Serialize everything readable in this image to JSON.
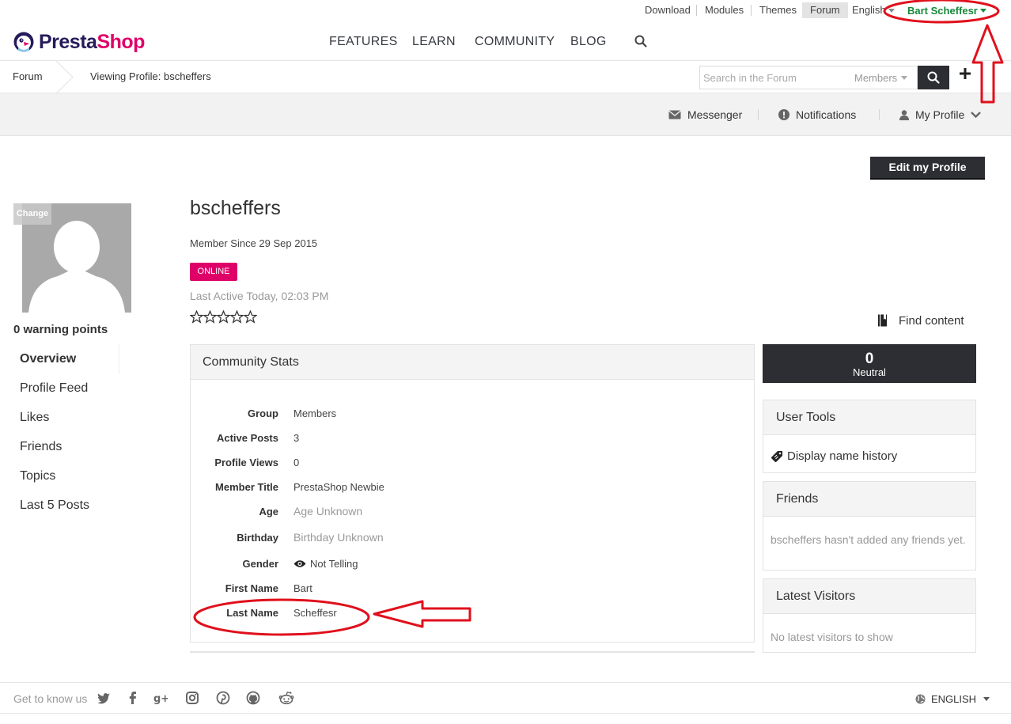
{
  "topbar": {
    "links": [
      "Download",
      "Modules",
      "Themes",
      "Forum",
      "English"
    ],
    "user_name": "Bart Scheffesr"
  },
  "brand": {
    "name_part1": "Presta",
    "name_part2": "Shop",
    "colors": {
      "navy": "#251b5b",
      "pink": "#df0067",
      "green": "#168a3a",
      "dark": "#2c2e33",
      "annotation": "#e0101c"
    }
  },
  "main_nav": [
    "FEATURES",
    "LEARN",
    "COMMUNITY",
    "BLOG"
  ],
  "breadcrumb": {
    "root": "Forum",
    "current": "Viewing Profile: bscheffers"
  },
  "search": {
    "placeholder": "Search in the Forum",
    "scope": "Members"
  },
  "userbar": {
    "messenger": "Messenger",
    "notifications": "Notifications",
    "my_profile": "My Profile"
  },
  "profile": {
    "edit_label": "Edit my Profile",
    "change_label": "Change",
    "username": "bscheffers",
    "member_since": "Member Since 29 Sep 2015",
    "status": "ONLINE",
    "last_active": "Last Active Today, 02:03 PM",
    "rating_stars": 0,
    "rating_max": 5,
    "warning_points": "0 warning points",
    "find_content": "Find content"
  },
  "side_nav": [
    "Overview",
    "Profile Feed",
    "Likes",
    "Friends",
    "Topics",
    "Last 5 Posts"
  ],
  "stats": {
    "title": "Community Stats",
    "rows": [
      {
        "label": "Group",
        "value": "Members"
      },
      {
        "label": "Active Posts",
        "value": "3"
      },
      {
        "label": "Profile Views",
        "value": "0"
      },
      {
        "label": "Member Title",
        "value": "PrestaShop Newbie"
      },
      {
        "label": "Age",
        "value": "Age Unknown"
      },
      {
        "label": "Birthday",
        "value": "Birthday Unknown"
      },
      {
        "label": "Gender",
        "value": "Not Telling"
      },
      {
        "label": "First Name",
        "value": "Bart"
      },
      {
        "label": "Last Name",
        "value": "Scheffesr"
      }
    ]
  },
  "reputation": {
    "value": "0",
    "label": "Neutral"
  },
  "widgets": {
    "user_tools": {
      "title": "User Tools",
      "link": "Display name history"
    },
    "friends": {
      "title": "Friends",
      "text": "bscheffers hasn't added any friends yet."
    },
    "latest_visitors": {
      "title": "Latest Visitors",
      "text": "No latest visitors to show"
    }
  },
  "footer": {
    "text": "Get to know us",
    "social_icons": [
      "twitter-icon",
      "facebook-icon",
      "google-plus-icon",
      "instagram-icon",
      "pinterest-icon",
      "github-icon",
      "reddit-icon"
    ],
    "language": "ENGLISH"
  }
}
